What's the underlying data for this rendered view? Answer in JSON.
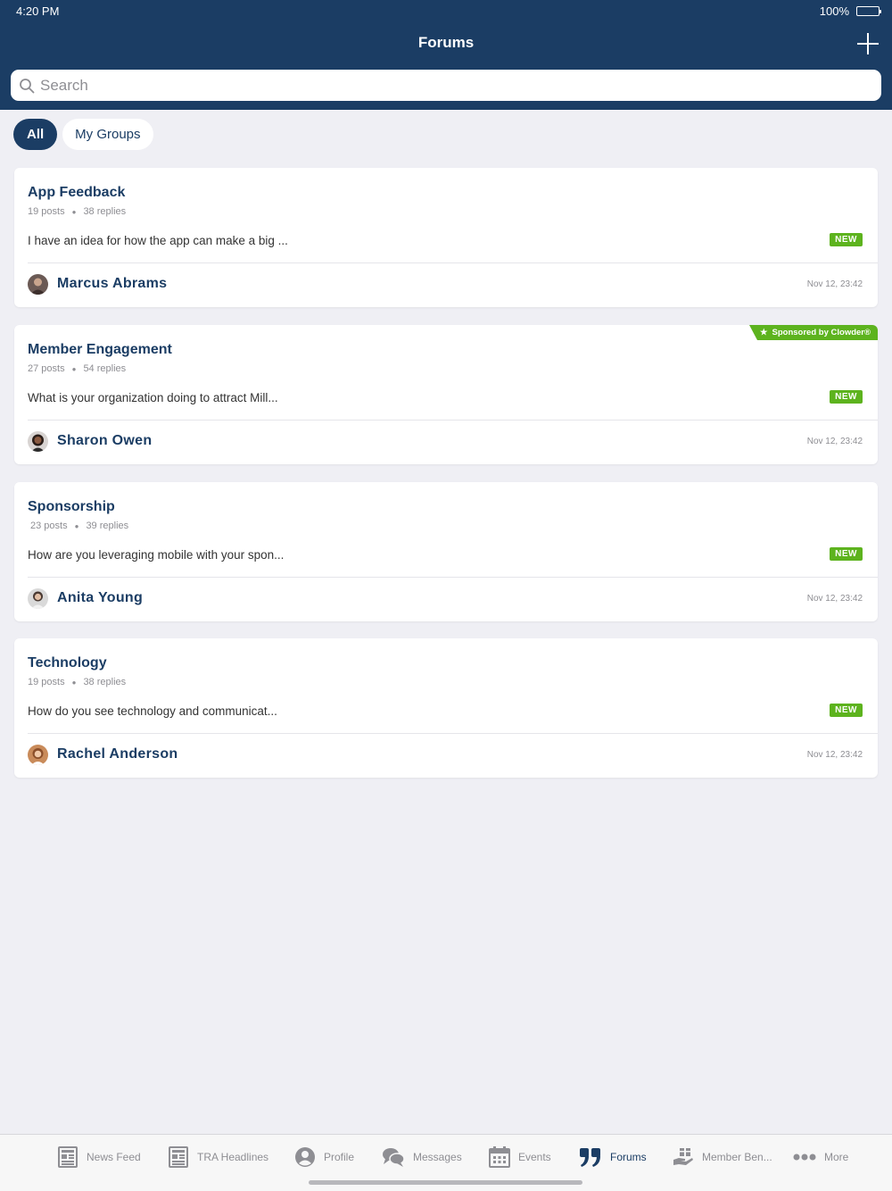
{
  "status_bar": {
    "time": "4:20 PM",
    "battery": "100%"
  },
  "header": {
    "title": "Forums"
  },
  "search": {
    "placeholder": "Search"
  },
  "filters": [
    "All",
    "My Groups"
  ],
  "forums": [
    {
      "title": "App Feedback",
      "posts": "19 posts",
      "replies": "38 replies",
      "preview": "I have an idea for how the app can make a big ...",
      "badge": "NEW",
      "author": "Marcus Abrams",
      "timestamp": "Nov 12, 23:42"
    },
    {
      "title": "Member Engagement",
      "posts": "27 posts",
      "replies": "54 replies",
      "preview": "What is your organization doing to attract Mill...",
      "badge": "NEW",
      "author": "Sharon Owen",
      "timestamp": "Nov 12, 23:42",
      "sponsor": "Sponsored by Clowder®"
    },
    {
      "title": "Sponsorship",
      "posts": "23 posts",
      "replies": "39 replies",
      "preview": "How are you leveraging mobile with your spon...",
      "badge": "NEW",
      "author": "Anita Young",
      "timestamp": "Nov 12, 23:42"
    },
    {
      "title": "Technology",
      "posts": "19 posts",
      "replies": "38 replies",
      "preview": "How do you see technology and communicat...",
      "badge": "NEW",
      "author": "Rachel Anderson",
      "timestamp": "Nov 12, 23:42"
    }
  ],
  "tabs": [
    {
      "label": "News Feed",
      "icon": "newspaper-icon"
    },
    {
      "label": "TRA Headlines",
      "icon": "newspaper-icon"
    },
    {
      "label": "Profile",
      "icon": "profile-icon"
    },
    {
      "label": "Messages",
      "icon": "chat-bubbles-icon"
    },
    {
      "label": "Events",
      "icon": "calendar-icon"
    },
    {
      "label": "Forums",
      "icon": "quote-icon"
    },
    {
      "label": "Member Ben...",
      "icon": "hand-gift-icon"
    },
    {
      "label": "More",
      "icon": "ellipsis-icon"
    }
  ],
  "active_tab": "Forums",
  "colors": {
    "brand_navy": "#1b3d64",
    "badge_green": "#5db31e",
    "background": "#efeff4"
  }
}
